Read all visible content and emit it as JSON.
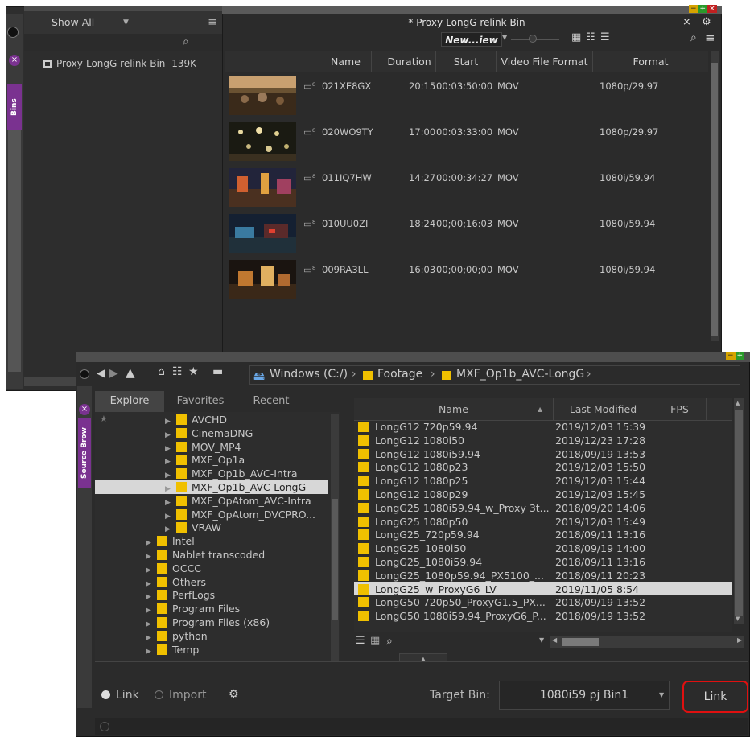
{
  "bins_panel": {
    "filter_value": "Show All",
    "tab_label": "Bins",
    "bin_item": "Proxy-LongG relink Bin",
    "bin_size": "139K"
  },
  "proxy_bin": {
    "title": "* Proxy-LongG relink Bin",
    "view_name": "New...iew",
    "columns": [
      "Name",
      "Duration",
      "Start",
      "Video File Format",
      "Format"
    ],
    "rows": [
      {
        "name": "021XE8GX",
        "duration": "20:15",
        "start": "00:03:50:00",
        "vff": "MOV",
        "format": "1080p/29.97"
      },
      {
        "name": "020WO9TY",
        "duration": "17:00",
        "start": "00:03:33:00",
        "vff": "MOV",
        "format": "1080p/29.97"
      },
      {
        "name": "011IQ7HW",
        "duration": "14:27",
        "start": "00:00:34:27",
        "vff": "MOV",
        "format": "1080i/59.94"
      },
      {
        "name": "010UU0ZI",
        "duration": "18:24",
        "start": "00;00;16:03",
        "vff": "MOV",
        "format": "1080i/59.94"
      },
      {
        "name": "009RA3LL",
        "duration": "16:03",
        "start": "00;00;00;00",
        "vff": "MOV",
        "format": "1080i/59.94"
      }
    ]
  },
  "source_browser": {
    "tab_label": "Source Brow",
    "path": [
      "Windows (C:/)",
      "Footage",
      "MXF_Op1b_AVC-LongG"
    ],
    "tabs": [
      "Explore",
      "Favorites",
      "Recent"
    ],
    "tree": [
      {
        "label": "AVCHD",
        "level": 2
      },
      {
        "label": "CinemaDNG",
        "level": 2
      },
      {
        "label": "MOV_MP4",
        "level": 2
      },
      {
        "label": "MXF_Op1a",
        "level": 2
      },
      {
        "label": "MXF_Op1b_AVC-Intra",
        "level": 2
      },
      {
        "label": "MXF_Op1b_AVC-LongG",
        "level": 2
      },
      {
        "label": "MXF_OpAtom_AVC-Intra",
        "level": 2
      },
      {
        "label": "MXF_OpAtom_DVCPRO...",
        "level": 2
      },
      {
        "label": "VRAW",
        "level": 2
      },
      {
        "label": "Intel",
        "level": 1
      },
      {
        "label": "Nablet transcoded",
        "level": 1
      },
      {
        "label": "OCCC",
        "level": 1
      },
      {
        "label": "Others",
        "level": 1
      },
      {
        "label": "PerfLogs",
        "level": 1
      },
      {
        "label": "Program Files",
        "level": 1
      },
      {
        "label": "Program Files (x86)",
        "level": 1
      },
      {
        "label": "python",
        "level": 1
      },
      {
        "label": "Temp",
        "level": 1
      }
    ],
    "file_columns": [
      "Name",
      "Last Modified",
      "FPS"
    ],
    "files": [
      {
        "name": "LongG12 720p59.94",
        "date": "2019/12/03 15:39"
      },
      {
        "name": "LongG12 1080i50",
        "date": "2019/12/23 17:28"
      },
      {
        "name": "LongG12 1080i59.94",
        "date": "2018/09/19 13:53"
      },
      {
        "name": "LongG12 1080p23",
        "date": "2019/12/03 15:50"
      },
      {
        "name": "LongG12 1080p25",
        "date": "2019/12/03 15:44"
      },
      {
        "name": "LongG12 1080p29",
        "date": "2019/12/03 15:45"
      },
      {
        "name": "LongG25 1080i59.94_w_Proxy 3t...",
        "date": "2018/09/20 14:06"
      },
      {
        "name": "LongG25 1080p50",
        "date": "2019/12/03 15:49"
      },
      {
        "name": "LongG25_720p59.94",
        "date": "2018/09/11 13:16"
      },
      {
        "name": "LongG25_1080i50",
        "date": "2018/09/19 14:00"
      },
      {
        "name": "LongG25_1080i59.94",
        "date": "2018/09/11 13:16"
      },
      {
        "name": "LongG25_1080p59.94_PX5100_...",
        "date": "2018/09/11 20:23"
      },
      {
        "name": "LongG25_w_ProxyG6_LV",
        "date": "2019/11/05 8:54"
      },
      {
        "name": "LongG50 720p50_ProxyG1.5_PX...",
        "date": "2018/09/19 13:52"
      },
      {
        "name": "LongG50 1080i59.94_ProxyG6_P...",
        "date": "2018/09/19 13:52"
      }
    ],
    "mode_link": "Link",
    "mode_import": "Import",
    "target_bin_label": "Target Bin:",
    "target_bin_value": "1080i59 pj Bin1",
    "link_button": "Link"
  }
}
